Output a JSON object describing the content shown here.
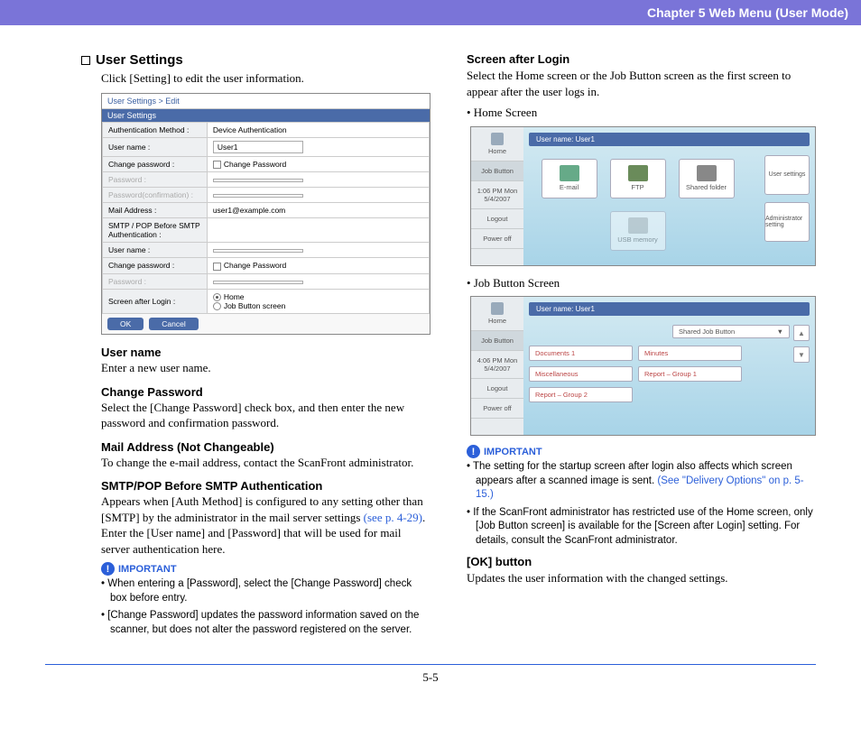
{
  "header": {
    "chapter": "Chapter 5   Web Menu (User Mode)"
  },
  "left": {
    "section_title": "User Settings",
    "intro": "Click [Setting] to edit the user information.",
    "fig1": {
      "crumb": "User Settings > Edit",
      "title": "User Settings",
      "rows": {
        "auth_label": "Authentication Method :",
        "auth_val": "Device Authentication",
        "user_label": "User name :",
        "user_val": "User1",
        "chpw_label": "Change password :",
        "chpw_cb": "Change Password",
        "pw_label": "Password :",
        "pwc_label": "Password(confirmation) :",
        "mail_label": "Mail Address :",
        "mail_val": "user1@example.com",
        "smtp_label": "SMTP / POP Before SMTP Authentication :",
        "user2_label": "User name :",
        "chpw2_label": "Change password :",
        "chpw2_cb": "Change Password",
        "pw2_label": "Password :",
        "scr_label": "Screen after Login :",
        "scr_opt1": "Home",
        "scr_opt2": "Job Button screen"
      },
      "ok": "OK",
      "cancel": "Cancel"
    },
    "username_h": "User name",
    "username_p": "Enter a new user name.",
    "chpw_h": "Change Password",
    "chpw_p": "Select the [Change Password] check box, and then enter the new password and confirmation password.",
    "mail_h": "Mail Address (Not Changeable)",
    "mail_p": "To change the e-mail address, contact the ScanFront administrator.",
    "smtp_h": "SMTP/POP Before SMTP Authentication",
    "smtp_p1": "Appears when [Auth Method] is configured to any setting other than [SMTP] by the administrator in the mail server settings ",
    "smtp_link": "(see p. 4-29)",
    "smtp_p2": ". Enter the [User name] and [Password] that will be used for mail server authentication here.",
    "important": "IMPORTANT",
    "note1": "When entering a [Password], select the [Change Password] check box before entry.",
    "note2": "[Change Password] updates the password information saved on the scanner, but does not alter the password registered on the server."
  },
  "right": {
    "scr_h": "Screen after Login",
    "scr_p": "Select the Home screen or the Job Button screen as the first screen to appear after the user logs in.",
    "home_bullet": "• Home Screen",
    "job_bullet": "• Job Button Screen",
    "ss1": {
      "user": "User name: User1",
      "sb_home": "Home",
      "sb_job": "Job Button",
      "sb_time": "1:06 PM   Mon 5/4/2007",
      "sb_logout": "Logout",
      "sb_power": "Power off",
      "t_email": "E-mail",
      "t_ftp": "FTP",
      "t_shared": "Shared folder",
      "t_usb": "USB memory",
      "t_user": "User settings",
      "t_admin": "Administrator setting"
    },
    "ss2": {
      "user": "User name: User1",
      "sb_home": "Home",
      "sb_job": "Job Button",
      "sb_time": "4:06 PM   Mon 5/4/2007",
      "sb_logout": "Logout",
      "sb_power": "Power off",
      "dd": "Shared Job Button",
      "j1": "Documents 1",
      "j2": "Minutes",
      "j3": "Miscellaneous",
      "j4": "Report – Group 1",
      "j5": "Report – Group 2"
    },
    "important": "IMPORTANT",
    "rnote1a": "The setting for the startup screen after login also affects which screen appears after a scanned image is sent. ",
    "rnote1b": "(See \"Delivery Options\" on p. 5-15.)",
    "rnote2": "If the ScanFront administrator has restricted use of the Home screen, only [Job Button screen] is available for the [Screen after Login] setting. For details, consult the ScanFront administrator.",
    "ok_h": "[OK] button",
    "ok_p": "Updates the user information with the changed settings."
  },
  "footer": {
    "page": "5-5"
  }
}
